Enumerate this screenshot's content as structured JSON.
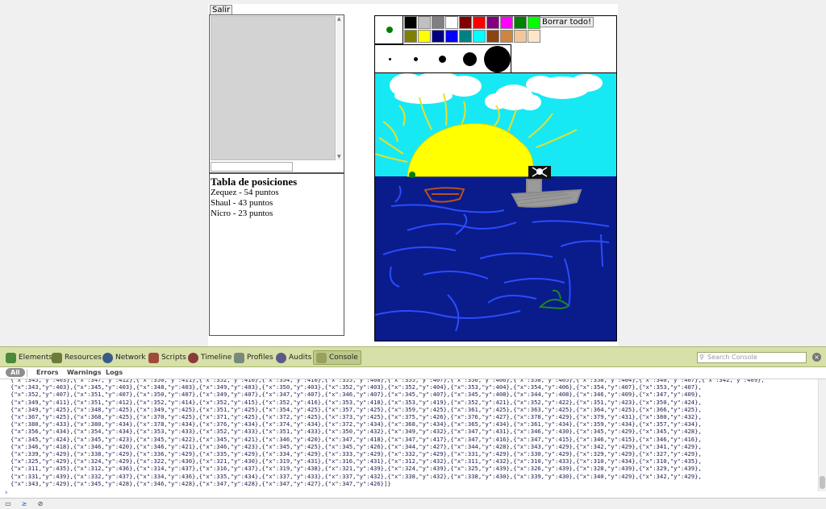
{
  "app": {
    "exit_label": "Salir",
    "clear_label": "Borrar todo!",
    "current_color": "#008000"
  },
  "palette": [
    "#000000",
    "#c0c0c0",
    "#808080",
    "#ffffff",
    "#800000",
    "#ff0000",
    "#800080",
    "#ff00ff",
    "#008000",
    "#00ff00",
    "#808000",
    "#ffff00",
    "#000080",
    "#0000ff",
    "#008080",
    "#00ffff",
    "#8b4513",
    "#cd853f",
    "#f4c69a",
    "#fde5c7"
  ],
  "brushes": [
    {
      "name": "brush-size-1"
    },
    {
      "name": "brush-size-2"
    },
    {
      "name": "brush-size-3"
    },
    {
      "name": "brush-size-4"
    },
    {
      "name": "brush-size-5"
    }
  ],
  "scoreboard": {
    "title": "Tabla de posiciones",
    "rows": [
      "Zequez - 54 puntos",
      "Shaul - 43 puntos",
      "Nicro - 23 puntos"
    ]
  },
  "devtools": {
    "tabs": [
      {
        "label": "Elements",
        "icon": "elements-icon",
        "color": "#4a8a3a"
      },
      {
        "label": "Resources",
        "icon": "resources-icon",
        "color": "#6b7c3a"
      },
      {
        "label": "Network",
        "icon": "network-icon",
        "color": "#3a5a8a"
      },
      {
        "label": "Scripts",
        "icon": "scripts-icon",
        "color": "#a04a3a"
      },
      {
        "label": "Timeline",
        "icon": "timeline-icon",
        "color": "#8a3a3a"
      },
      {
        "label": "Profiles",
        "icon": "profiles-icon",
        "color": "#7a8a7a"
      },
      {
        "label": "Audits",
        "icon": "audits-icon",
        "color": "#5a5a8a"
      },
      {
        "label": "Console",
        "icon": "console-icon",
        "color": "#9aa060"
      }
    ],
    "active_tab": "Console",
    "search_placeholder": "Search Console",
    "filters": [
      "All",
      "Errors",
      "Warnings",
      "Logs"
    ],
    "console_lines": [
      "{\"x\":345,\"y\":403},{\"x\":347,\"y\":412},{\"x\":350,\"y\":411},{\"x\":352,\"y\":410},{\"x\":354,\"y\":410},{\"x\":355,\"y\":408},{\"x\":355,\"y\":407},{\"x\":356,\"y\":406},{\"x\":358,\"y\":405},{\"x\":358,\"y\":404},{\"x\":340,\"y\":407},{\"x\":342,\"y\":409},",
      "{\"x\":343,\"y\":403},{\"x\":345,\"y\":403},{\"x\":348,\"y\":403},{\"x\":349,\"y\":403},{\"x\":350,\"y\":403},{\"x\":352,\"y\":403},{\"x\":352,\"y\":404},{\"x\":353,\"y\":404},{\"x\":354,\"y\":406},{\"x\":354,\"y\":407},{\"x\":353,\"y\":407},",
      "{\"x\":352,\"y\":407},{\"x\":351,\"y\":407},{\"x\":350,\"y\":407},{\"x\":349,\"y\":407},{\"x\":347,\"y\":407},{\"x\":346,\"y\":407},{\"x\":345,\"y\":407},{\"x\":345,\"y\":408},{\"x\":344,\"y\":408},{\"x\":346,\"y\":409},{\"x\":347,\"y\":409},",
      "{\"x\":349,\"y\":411},{\"x\":351,\"y\":412},{\"x\":352,\"y\":414},{\"x\":352,\"y\":415},{\"x\":352,\"y\":416},{\"x\":353,\"y\":418},{\"x\":353,\"y\":419},{\"x\":352,\"y\":421},{\"x\":352,\"y\":422},{\"x\":351,\"y\":423},{\"x\":350,\"y\":424},",
      "{\"x\":349,\"y\":425},{\"x\":348,\"y\":425},{\"x\":349,\"y\":425},{\"x\":351,\"y\":425},{\"x\":354,\"y\":425},{\"x\":357,\"y\":425},{\"x\":359,\"y\":425},{\"x\":361,\"y\":425},{\"x\":363,\"y\":425},{\"x\":364,\"y\":425},{\"x\":366,\"y\":425},",
      "{\"x\":367,\"y\":425},{\"x\":368,\"y\":425},{\"x\":370,\"y\":425},{\"x\":371,\"y\":425},{\"x\":372,\"y\":425},{\"x\":373,\"y\":425},{\"x\":375,\"y\":426},{\"x\":376,\"y\":427},{\"x\":378,\"y\":429},{\"x\":379,\"y\":431},{\"x\":380,\"y\":432},",
      "{\"x\":380,\"y\":433},{\"x\":380,\"y\":434},{\"x\":378,\"y\":434},{\"x\":376,\"y\":434},{\"x\":374,\"y\":434},{\"x\":372,\"y\":434},{\"x\":368,\"y\":434},{\"x\":365,\"y\":434},{\"x\":361,\"y\":434},{\"x\":359,\"y\":434},{\"x\":357,\"y\":434},",
      "{\"x\":356,\"y\":434},{\"x\":354,\"y\":434},{\"x\":353,\"y\":433},{\"x\":352,\"y\":433},{\"x\":351,\"y\":433},{\"x\":350,\"y\":432},{\"x\":349,\"y\":432},{\"x\":347,\"y\":431},{\"x\":346,\"y\":430},{\"x\":345,\"y\":429},{\"x\":345,\"y\":428},",
      "{\"x\":345,\"y\":424},{\"x\":345,\"y\":423},{\"x\":345,\"y\":422},{\"x\":345,\"y\":421},{\"x\":346,\"y\":420},{\"x\":347,\"y\":418},{\"x\":347,\"y\":417},{\"x\":347,\"y\":416},{\"x\":347,\"y\":415},{\"x\":346,\"y\":415},{\"x\":346,\"y\":416},",
      "{\"x\":346,\"y\":418},{\"x\":346,\"y\":420},{\"x\":346,\"y\":421},{\"x\":346,\"y\":423},{\"x\":345,\"y\":425},{\"x\":345,\"y\":426},{\"x\":344,\"y\":427},{\"x\":344,\"y\":428},{\"x\":343,\"y\":429},{\"x\":342,\"y\":429},{\"x\":341,\"y\":429},",
      "{\"x\":339,\"y\":429},{\"x\":338,\"y\":429},{\"x\":336,\"y\":429},{\"x\":335,\"y\":429},{\"x\":334,\"y\":429},{\"x\":333,\"y\":429},{\"x\":332,\"y\":429},{\"x\":331,\"y\":429},{\"x\":330,\"y\":429},{\"x\":329,\"y\":429},{\"x\":327,\"y\":429},",
      "{\"x\":325,\"y\":429},{\"x\":324,\"y\":429},{\"x\":322,\"y\":430},{\"x\":321,\"y\":430},{\"x\":319,\"y\":431},{\"x\":316,\"y\":431},{\"x\":312,\"y\":432},{\"x\":311,\"y\":432},{\"x\":310,\"y\":433},{\"x\":310,\"y\":434},{\"x\":310,\"y\":435},",
      "{\"x\":311,\"y\":435},{\"x\":312,\"y\":436},{\"x\":314,\"y\":437},{\"x\":316,\"y\":437},{\"x\":319,\"y\":438},{\"x\":321,\"y\":439},{\"x\":324,\"y\":439},{\"x\":325,\"y\":439},{\"x\":326,\"y\":439},{\"x\":328,\"y\":439},{\"x\":329,\"y\":439},",
      "{\"x\":331,\"y\":439},{\"x\":332,\"y\":437},{\"x\":334,\"y\":436},{\"x\":335,\"y\":434},{\"x\":337,\"y\":433},{\"x\":337,\"y\":432},{\"x\":338,\"y\":432},{\"x\":338,\"y\":430},{\"x\":339,\"y\":430},{\"x\":340,\"y\":429},{\"x\":342,\"y\":429},",
      "{\"x\":343,\"y\":429},{\"x\":345,\"y\":428},{\"x\":346,\"y\":428},{\"x\":347,\"y\":428},{\"x\":347,\"y\":427},{\"x\":347,\"y\":426}]}"
    ]
  }
}
